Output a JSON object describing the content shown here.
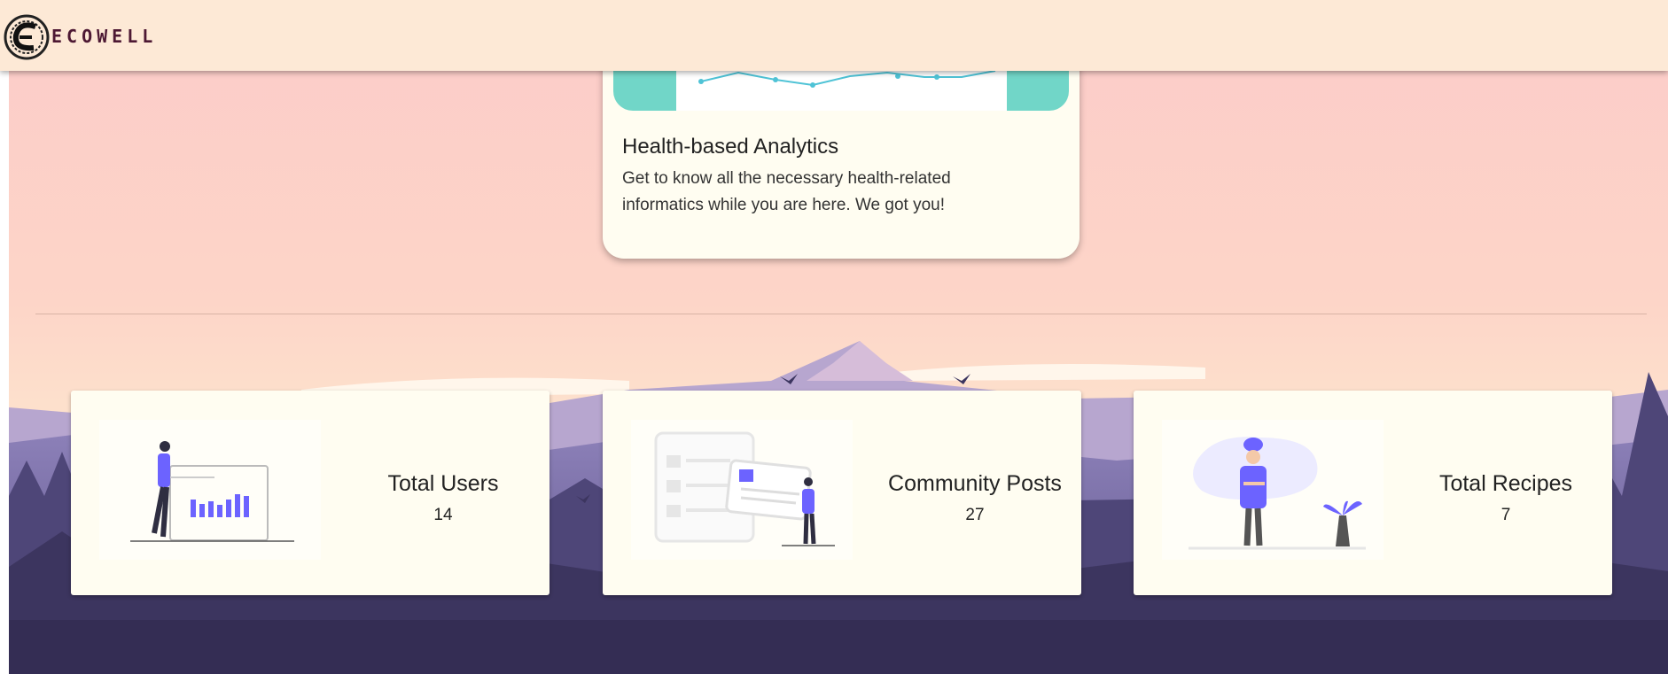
{
  "navbar": {
    "brand": "ECOWELL"
  },
  "feature": {
    "title": "Health-based Analytics",
    "description": "Get to know all the necessary health-related informatics while you are here. We got you!"
  },
  "stats": [
    {
      "title": "Total Users",
      "value": "14"
    },
    {
      "title": "Community Posts",
      "value": "27"
    },
    {
      "title": "Total Recipes",
      "value": "7"
    }
  ],
  "colors": {
    "navbar_bg": "#fde9d6",
    "brand_text": "#4d1833",
    "card_bg": "#fffdf1",
    "accent_teal": "#71d6c8",
    "illustration_purple": "#6c63ff"
  }
}
